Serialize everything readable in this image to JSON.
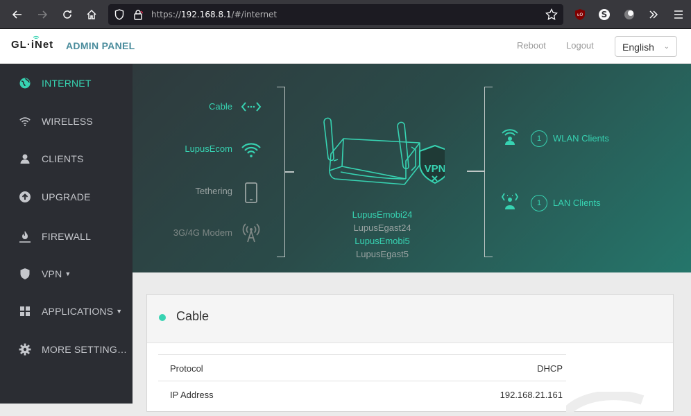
{
  "browser": {
    "url_prefix": "https://",
    "url_host": "192.168.8.1",
    "url_path": "/#/internet"
  },
  "header": {
    "logo": "GL·iNet",
    "title": "ADMIN PANEL",
    "reboot": "Reboot",
    "logout": "Logout",
    "language": "English"
  },
  "sidebar": {
    "items": [
      {
        "label": "INTERNET",
        "icon": "globe-icon"
      },
      {
        "label": "WIRELESS",
        "icon": "wifi-icon"
      },
      {
        "label": "CLIENTS",
        "icon": "user-icon"
      },
      {
        "label": "UPGRADE",
        "icon": "upload-icon"
      },
      {
        "label": "FIREWALL",
        "icon": "fire-icon"
      },
      {
        "label": "VPN",
        "icon": "shield-icon"
      },
      {
        "label": "APPLICATIONS",
        "icon": "grid-icon"
      },
      {
        "label": "MORE SETTING…",
        "icon": "gear-icon"
      }
    ]
  },
  "hero": {
    "sources": [
      {
        "label": "Cable",
        "active": true
      },
      {
        "label": "LupusEcom",
        "active": true
      },
      {
        "label": "Tethering",
        "active": false
      },
      {
        "label": "3G/4G Modem",
        "active": false
      }
    ],
    "vpn_label": "VPN",
    "ssids": [
      {
        "name": "LupusEmobi24",
        "active": true
      },
      {
        "name": "LupusEgast24",
        "active": false
      },
      {
        "name": "LupusEmobi5",
        "active": true
      },
      {
        "name": "LupusEgast5",
        "active": false
      }
    ],
    "clients": [
      {
        "count": "1",
        "label": "WLAN Clients"
      },
      {
        "count": "1",
        "label": "LAN Clients"
      }
    ]
  },
  "card": {
    "title": "Cable",
    "rows": [
      {
        "key": "Protocol",
        "value": "DHCP"
      },
      {
        "key": "IP Address",
        "value": "192.168.21.161"
      }
    ]
  },
  "colors": {
    "accent": "#37d3b2",
    "inactive": "#9aa3a2",
    "sidebar_bg": "#2b2d33"
  }
}
